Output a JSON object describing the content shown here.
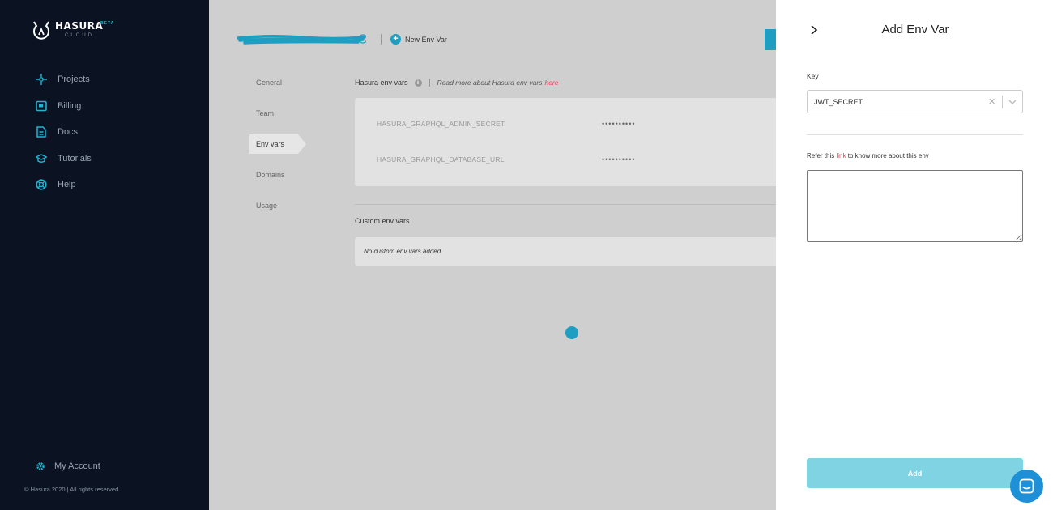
{
  "sidebar": {
    "logo": {
      "name": "HASURA",
      "badge": "BETA",
      "sub": "CLOUD"
    },
    "items": [
      {
        "label": "Projects",
        "icon": "projects-icon"
      },
      {
        "label": "Billing",
        "icon": "billing-icon"
      },
      {
        "label": "Docs",
        "icon": "docs-icon"
      },
      {
        "label": "Tutorials",
        "icon": "tutorials-icon"
      },
      {
        "label": "Help",
        "icon": "help-icon"
      }
    ],
    "account_label": "My Account",
    "footer": "© Hasura 2020  |  All rights reserved"
  },
  "topbar": {
    "new_env_label": "New Env Var"
  },
  "subnav": {
    "items": [
      "General",
      "Team",
      "Env vars",
      "Domains",
      "Usage"
    ],
    "active": "Env vars"
  },
  "hasura_env": {
    "title": "Hasura env vars",
    "read_more": "Read more about Hasura env vars",
    "link": "here",
    "rows": [
      {
        "key": "HASURA_GRAPHQL_ADMIN_SECRET",
        "value": "••••••••••"
      },
      {
        "key": "HASURA_GRAPHQL_DATABASE_URL",
        "value": "••••••••••"
      }
    ]
  },
  "custom_env": {
    "title": "Custom env vars",
    "empty": "No custom env vars added"
  },
  "drawer": {
    "title": "Add Env Var",
    "key_label": "Key",
    "key_value": "JWT_SECRET",
    "refer_prefix": "Refer this",
    "refer_link": "link",
    "refer_suffix": "to know more about this env",
    "add_label": "Add"
  },
  "colors": {
    "accent": "#1e9fc1",
    "link": "#e8425d",
    "sidebar_bg": "#0b1221",
    "add_button": "#7fd3e3"
  }
}
